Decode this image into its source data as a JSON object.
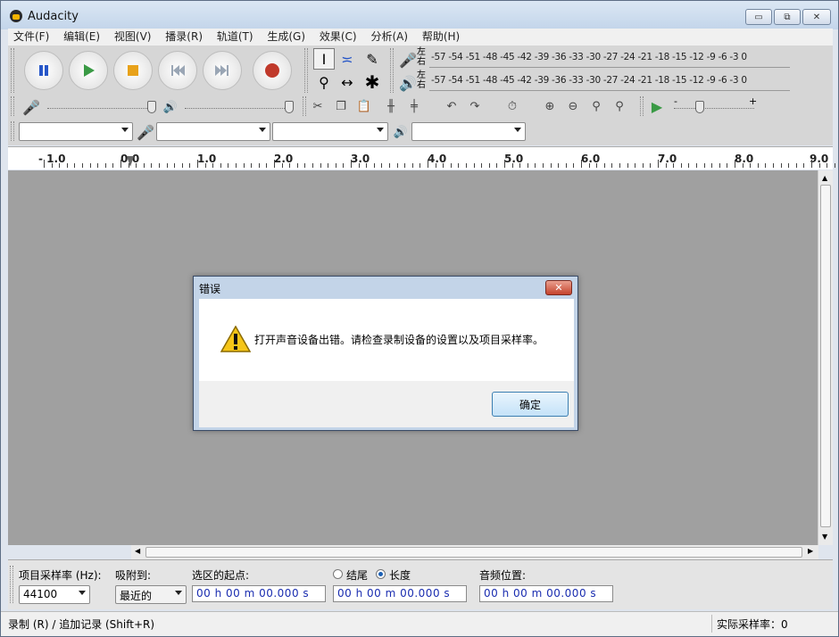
{
  "window": {
    "title": "Audacity",
    "caption_buttons": {
      "minimize": "▭",
      "maximize": "⧉",
      "close": "✕"
    }
  },
  "menu": [
    "文件(F)",
    "编辑(E)",
    "视图(V)",
    "播录(R)",
    "轨道(T)",
    "生成(G)",
    "效果(C)",
    "分析(A)",
    "帮助(H)"
  ],
  "transport": {
    "pause_color": "#2656c8",
    "play_color": "#3a9a45",
    "stop_color": "#e8a21a",
    "record_color": "#c0392b"
  },
  "meters": {
    "record_channels": "左\n右",
    "play_channels": "左\n右",
    "scale": "-57 -54 -51 -48 -45 -42 -39 -36 -33 -30 -27 -24 -21 -18 -15 -12  -9   -6   -3   0"
  },
  "mixer": {
    "playback_speed_minus": "-",
    "playback_speed_plus": "+"
  },
  "devices": {
    "host": "",
    "input": "",
    "channels": "",
    "output": ""
  },
  "ruler": {
    "labels": [
      "- 1.0",
      "0.0",
      "1.0",
      "2.0",
      "3.0",
      "4.0",
      "5.0",
      "6.0",
      "7.0",
      "8.0",
      "9.0"
    ]
  },
  "bottom": {
    "rate_label": "项目采样率 (Hz):",
    "rate_value": "44100",
    "snap_label": "吸附到:",
    "snap_value": "最近的",
    "sel_start_label": "选区的起点:",
    "end_label": "结尾",
    "length_label": "长度",
    "audio_pos_label": "音频位置:",
    "time_value": "00 h 00 m 00.000 s"
  },
  "status": {
    "left": "录制 (R) / 追加记录 (Shift+R)",
    "right": "实际采样率：0"
  },
  "dialog": {
    "title": "错误",
    "message": "打开声音设备出错。请检查录制设备的设置以及项目采样率。",
    "ok_label": "确定"
  }
}
